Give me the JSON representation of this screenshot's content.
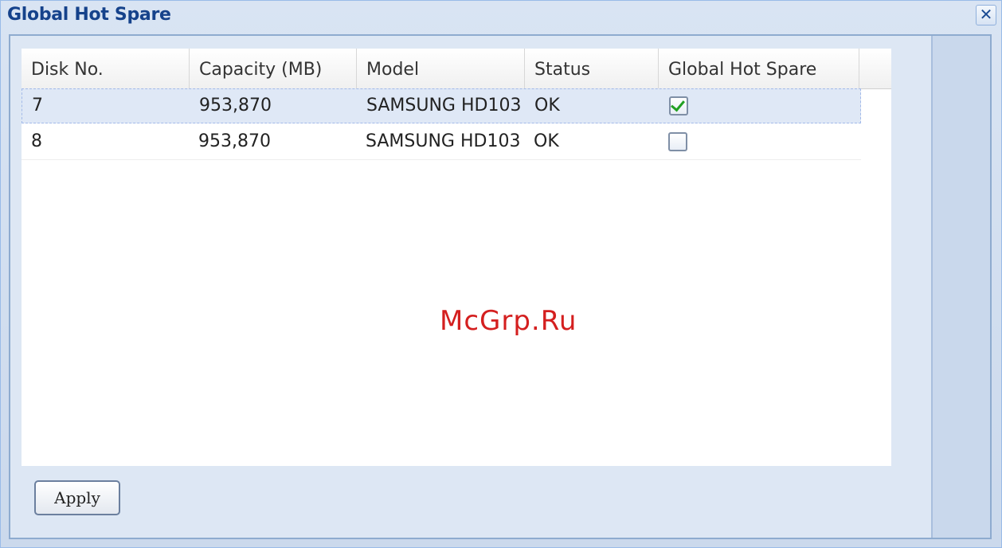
{
  "window": {
    "title": "Global Hot Spare",
    "close_label": "✕"
  },
  "grid": {
    "columns": [
      {
        "label": "Disk No."
      },
      {
        "label": "Capacity (MB)"
      },
      {
        "label": "Model"
      },
      {
        "label": "Status"
      },
      {
        "label": "Global Hot Spare"
      }
    ],
    "rows": [
      {
        "disk_no": "7",
        "capacity": "953,870",
        "model": "SAMSUNG HD103",
        "status": "OK",
        "global_hot_spare": true,
        "selected": true
      },
      {
        "disk_no": "8",
        "capacity": "953,870",
        "model": "SAMSUNG HD103",
        "status": "OK",
        "global_hot_spare": false,
        "selected": false
      }
    ]
  },
  "watermark": "McGrp.Ru",
  "buttons": {
    "apply_label": "Apply"
  },
  "colors": {
    "title": "#15428b",
    "selected_row": "#dfe8f6",
    "checkmark": "#22a022",
    "watermark": "#d41f1f"
  },
  "icons": {
    "close": "close-icon",
    "check": "checkmark-icon"
  }
}
